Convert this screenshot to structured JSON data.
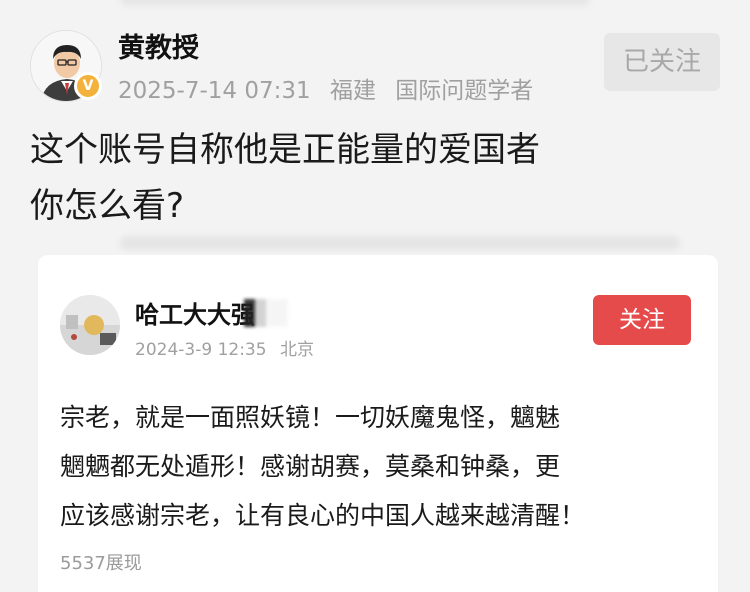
{
  "post": {
    "author": "黄教授",
    "verified_badge": "V",
    "date": "2025-7-14 07:31",
    "location": "福建",
    "title_tag": "国际问题学者",
    "follow_state": "已关注",
    "text_line1": "这个账号自称他是正能量的爱国者",
    "text_line2": "你怎么看?"
  },
  "quoted": {
    "author": "哈工大大强",
    "date": "2024-3-9 12:35",
    "location": "北京",
    "follow_label": "关注",
    "body_line1": "宗老，就是一面照妖镜！一切妖魔鬼怪，魑魅",
    "body_line2": "魍魉都无处遁形！感谢胡赛，莫桑和钟桑，更",
    "body_line3": "应该感谢宗老，让有良心的中国人越来越清醒！",
    "views": "5537展现"
  },
  "colors": {
    "follow_red": "#e64b4b",
    "badge_gold": "#f2b23c",
    "meta_gray": "#a0a0a0"
  }
}
